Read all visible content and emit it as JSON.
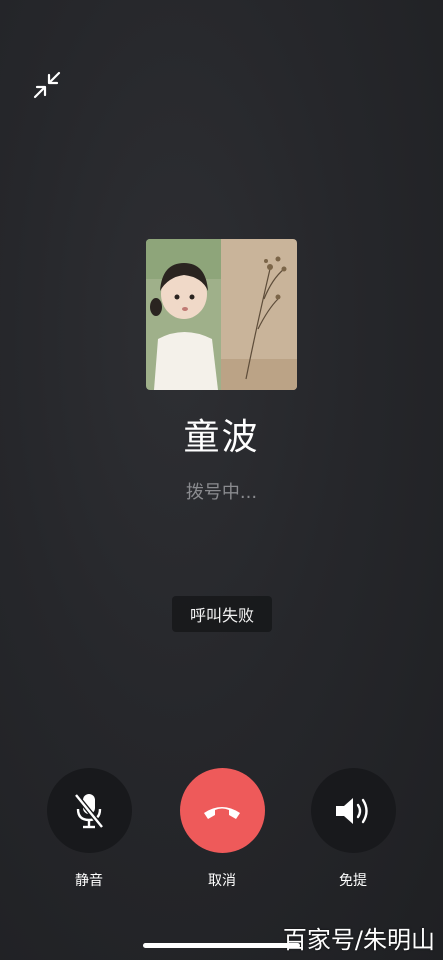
{
  "call": {
    "caller_name": "童波",
    "status": "拨号中...",
    "toast": "呼叫失败"
  },
  "controls": {
    "mute_label": "静音",
    "cancel_label": "取消",
    "speaker_label": "免提"
  },
  "icons": {
    "minimize": "minimize-arrows-icon",
    "mute": "microphone-off-icon",
    "hangup": "phone-hangup-icon",
    "speaker": "speaker-icon"
  },
  "colors": {
    "hangup_red": "#ee5a5a",
    "button_dark": "#18191c",
    "background": "#26272b"
  },
  "watermark": "百家号/朱明山"
}
